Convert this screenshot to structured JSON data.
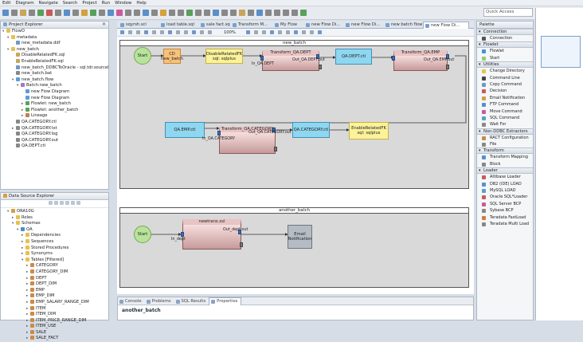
{
  "menubar": [
    "Edit",
    "Diagram",
    "Navigate",
    "Search",
    "Project",
    "Run",
    "Window",
    "Help"
  ],
  "quick_access": "Quick Access",
  "project_explorer": {
    "title": "Project Explorer",
    "items": [
      {
        "label": "FlowO",
        "indent": 0,
        "tri": "▾",
        "icon": "folder-icon",
        "color": "#e8c050"
      },
      {
        "label": "metadata",
        "indent": 1,
        "tri": "▾",
        "icon": "folder-icon",
        "color": "#e8c050"
      },
      {
        "label": "new_metadata.ddf",
        "indent": 2,
        "tri": "",
        "icon": "file-icon",
        "color": "#6f97c9"
      },
      {
        "label": "new_batch",
        "indent": 1,
        "tri": "▾",
        "icon": "folder-icon",
        "color": "#e8c050"
      },
      {
        "label": "DisableRelatedFK.sql",
        "indent": 2,
        "tri": "",
        "icon": "sql-file-icon",
        "color": "#c9a55c"
      },
      {
        "label": "EnableRelatedFK.sql",
        "indent": 2,
        "tri": "",
        "icon": "sql-file-icon",
        "color": "#c9a55c"
      },
      {
        "label": "new_batch_DDBCToOracle - sql.tdr.sourcel",
        "indent": 2,
        "tri": "",
        "icon": "file-icon",
        "color": "#6f97c9"
      },
      {
        "label": "new_batch.bat",
        "indent": 2,
        "tri": "",
        "icon": "file-icon",
        "color": "#888888"
      },
      {
        "label": "new_batch.flow",
        "indent": 2,
        "tri": "▾",
        "icon": "flow-file-icon",
        "color": "#5c9dd6"
      },
      {
        "label": "Batch:new_batch",
        "indent": 3,
        "tri": "▾",
        "icon": "batch-icon",
        "color": "#9c7cc7"
      },
      {
        "label": "new Flow Diagram",
        "indent": 4,
        "tri": "",
        "icon": "diagram-icon",
        "color": "#5c9dd6"
      },
      {
        "label": "new Flow Diagram",
        "indent": 4,
        "tri": "",
        "icon": "diagram-icon",
        "color": "#5c9dd6"
      },
      {
        "label": "Flowlet: new_batch",
        "indent": 4,
        "tri": "▸",
        "icon": "flowlet-icon",
        "color": "#57a35a"
      },
      {
        "label": "Flowlet: another_batch",
        "indent": 4,
        "tri": "▸",
        "icon": "flowlet-icon",
        "color": "#57a35a"
      },
      {
        "label": "Lineage",
        "indent": 4,
        "tri": "▸",
        "icon": "lineage-icon",
        "color": "#c77c4c"
      },
      {
        "label": "QA.CATEGORY.ctl",
        "indent": 2,
        "tri": "",
        "icon": "file-icon",
        "color": "#888888"
      },
      {
        "label": "QA.CATEGORY.txt",
        "indent": 2,
        "tri": "▸",
        "icon": "file-icon",
        "color": "#888888"
      },
      {
        "label": "QA.CATEGORY.log",
        "indent": 2,
        "tri": "",
        "icon": "file-icon",
        "color": "#888888"
      },
      {
        "label": "QA.CATEGORY.out",
        "indent": 2,
        "tri": "",
        "icon": "file-icon",
        "color": "#888888"
      },
      {
        "label": "QA.DEPT.ctl",
        "indent": 2,
        "tri": "",
        "icon": "file-icon",
        "color": "#888888"
      }
    ]
  },
  "data_source_explorer": {
    "title": "Data Source Explorer",
    "items": [
      {
        "label": "ORA10G",
        "indent": 1,
        "tri": "▾",
        "icon": "database-icon",
        "color": "#d4a040"
      },
      {
        "label": "Roles",
        "indent": 2,
        "tri": "▸",
        "icon": "folder-icon",
        "color": "#e8c050"
      },
      {
        "label": "Schemas",
        "indent": 2,
        "tri": "▾",
        "icon": "folder-icon",
        "color": "#e8c050"
      },
      {
        "label": "QA",
        "indent": 3,
        "tri": "▾",
        "icon": "schema-icon",
        "color": "#4f8cc9"
      },
      {
        "label": "Dependencies",
        "indent": 4,
        "tri": "▸",
        "icon": "folder-icon",
        "color": "#e8c050"
      },
      {
        "label": "Sequences",
        "indent": 4,
        "tri": "▸",
        "icon": "folder-icon",
        "color": "#e8c050"
      },
      {
        "label": "Stored Procedures",
        "indent": 4,
        "tri": "▸",
        "icon": "folder-icon",
        "color": "#e8c050"
      },
      {
        "label": "Synonyms",
        "indent": 4,
        "tri": "▸",
        "icon": "folder-icon",
        "color": "#e8c050"
      },
      {
        "label": "Tables [Filtered]",
        "indent": 4,
        "tri": "▾",
        "icon": "folder-icon",
        "color": "#e8c050"
      },
      {
        "label": "CATEGORY",
        "indent": 5,
        "tri": "▸",
        "icon": "table-icon",
        "color": "#c98a4a"
      },
      {
        "label": "CATEGORY_DIM",
        "indent": 5,
        "tri": "▸",
        "icon": "table-icon",
        "color": "#c98a4a"
      },
      {
        "label": "DEPT",
        "indent": 5,
        "tri": "▸",
        "icon": "table-icon",
        "color": "#c98a4a"
      },
      {
        "label": "DEPT_DIM",
        "indent": 5,
        "tri": "▸",
        "icon": "table-icon",
        "color": "#c98a4a"
      },
      {
        "label": "EMP",
        "indent": 5,
        "tri": "▸",
        "icon": "table-icon",
        "color": "#c98a4a"
      },
      {
        "label": "EMP_DIM",
        "indent": 5,
        "tri": "▸",
        "icon": "table-icon",
        "color": "#c98a4a"
      },
      {
        "label": "EMP_SALARY_RANGE_DIM",
        "indent": 5,
        "tri": "▸",
        "icon": "table-icon",
        "color": "#c98a4a"
      },
      {
        "label": "ITEM",
        "indent": 5,
        "tri": "▸",
        "icon": "table-icon",
        "color": "#c98a4a"
      },
      {
        "label": "ITEM_DIM",
        "indent": 5,
        "tri": "▸",
        "icon": "table-icon",
        "color": "#c98a4a"
      },
      {
        "label": "ITEM_PRICE_RANGE_DIM",
        "indent": 5,
        "tri": "▸",
        "icon": "table-icon",
        "color": "#c98a4a"
      },
      {
        "label": "ITEM_USE",
        "indent": 5,
        "tri": "▸",
        "icon": "table-icon",
        "color": "#c98a4a"
      },
      {
        "label": "SALE",
        "indent": 5,
        "tri": "▸",
        "icon": "table-icon",
        "color": "#c98a4a"
      },
      {
        "label": "SALE_FACT",
        "indent": 5,
        "tri": "▸",
        "icon": "table-icon",
        "color": "#c98a4a"
      }
    ]
  },
  "editor_tabs": [
    {
      "label": "sqyrsh.scl",
      "active": false
    },
    {
      "label": "load table.sql",
      "active": false
    },
    {
      "label": "sale fact.sql",
      "active": false
    },
    {
      "label": "Transform M...",
      "active": false
    },
    {
      "label": "My Flow",
      "active": false
    },
    {
      "label": "new Flow Di...",
      "active": false
    },
    {
      "label": "new Flow Di...",
      "active": false
    },
    {
      "label": "new batch flow",
      "active": false
    },
    {
      "label": "new Flow Di...",
      "active": true
    }
  ],
  "editor_toolbar": {
    "zoom": "100%"
  },
  "diagram": {
    "lane1_title": "new_batch",
    "lane2_title": "another_batch",
    "start1": "Start",
    "n_cd": "CD\nnew_batch",
    "n_disable": "DisableRelatedFK\nsql: sqlplus",
    "t_dept_title": "Transform_QA.DEPT",
    "t_dept_in": "In_QA.DEPT",
    "t_dept_out": "Out_QA.DEPT.out",
    "f_dept_ctl": "QA.DEPT.ctl",
    "t_emp_title": "Transform_QA.EMP",
    "t_emp_out": "Out_QA.EMP.out",
    "f_emp_ctl": "QA.EMP.ctl",
    "t_cat_title": "Transform_QA.CATEGORY",
    "t_cat_in": "In_QA.CATEGORY",
    "t_cat_out": "Out_QA.CATEGORY.out",
    "f_cat_ctl": "QA.CATEGORY.ctl",
    "n_enable": "EnableRelatedFK\nsql: sqlplus",
    "start2": "Start",
    "t_new_title": "newtrans.xsl",
    "t_new_in": "In_dept",
    "t_new_out": "Out_dept.out",
    "n_email": "Email\nNotification"
  },
  "palette": {
    "title": "Palette",
    "sections": [
      {
        "title": "Connection",
        "items": [
          {
            "label": "Connection",
            "icon": "connection-icon",
            "color": "#555555"
          }
        ]
      },
      {
        "title": "Flowlet",
        "items": [
          {
            "label": "Flowlet",
            "icon": "flowlet-icon",
            "color": "#4a90d9"
          },
          {
            "label": "Start",
            "icon": "start-icon",
            "color": "#8fcf6a"
          }
        ]
      },
      {
        "title": "Utilities",
        "items": [
          {
            "label": "Change Directory",
            "icon": "folder-icon",
            "color": "#e8c050"
          },
          {
            "label": "Command Line",
            "icon": "terminal-icon",
            "color": "#444444"
          },
          {
            "label": "Copy Command",
            "icon": "copy-icon",
            "color": "#6f97c9"
          },
          {
            "label": "Decision",
            "icon": "decision-icon",
            "color": "#c95a5a"
          },
          {
            "label": "Email Notification",
            "icon": "email-icon",
            "color": "#d4a040"
          },
          {
            "label": "FTP Command",
            "icon": "ftp-icon",
            "color": "#5a8fc9"
          },
          {
            "label": "Move Command",
            "icon": "move-icon",
            "color": "#c95a9c"
          },
          {
            "label": "SQL Command",
            "icon": "sql-icon",
            "color": "#5aa0c9"
          },
          {
            "label": "Wait For",
            "icon": "wait-icon",
            "color": "#888888"
          }
        ]
      },
      {
        "title": "Non-DDBC Extractors",
        "items": [
          {
            "label": "RACT Configuration",
            "icon": "config-icon",
            "color": "#c98a4a"
          },
          {
            "label": "File",
            "icon": "file-icon",
            "color": "#888888"
          }
        ]
      },
      {
        "title": "Transform",
        "items": [
          {
            "label": "Transform Mapping",
            "icon": "transform-icon",
            "color": "#5a8fc9"
          },
          {
            "label": "Block",
            "icon": "block-icon",
            "color": "#888888"
          }
        ]
      },
      {
        "title": "Loader",
        "items": [
          {
            "label": "Altibase Loader",
            "icon": "loader-icon",
            "color": "#c95a5a"
          },
          {
            "label": "DB2 (IDE) LOAD",
            "icon": "loader-icon",
            "color": "#5a8fc9"
          },
          {
            "label": "MySQL LOAD",
            "icon": "loader-icon",
            "color": "#5aa0c9"
          },
          {
            "label": "Oracle SQL*Loader",
            "icon": "loader-icon",
            "color": "#c95a5a"
          },
          {
            "label": "SQL Server BCP",
            "icon": "loader-icon",
            "color": "#c95a9c"
          },
          {
            "label": "Sybase BCP",
            "icon": "loader-icon",
            "color": "#888888"
          },
          {
            "label": "Teradata FastLoad",
            "icon": "loader-icon",
            "color": "#d47a3a"
          },
          {
            "label": "Teradata Multi Load",
            "icon": "loader-icon",
            "color": "#888888"
          }
        ]
      }
    ]
  },
  "bottom_tabs": [
    {
      "label": "Console",
      "active": false
    },
    {
      "label": "Problems",
      "active": false
    },
    {
      "label": "SQL Results",
      "active": false
    },
    {
      "label": "Properties",
      "active": true
    }
  ],
  "properties_title": "another_batch"
}
